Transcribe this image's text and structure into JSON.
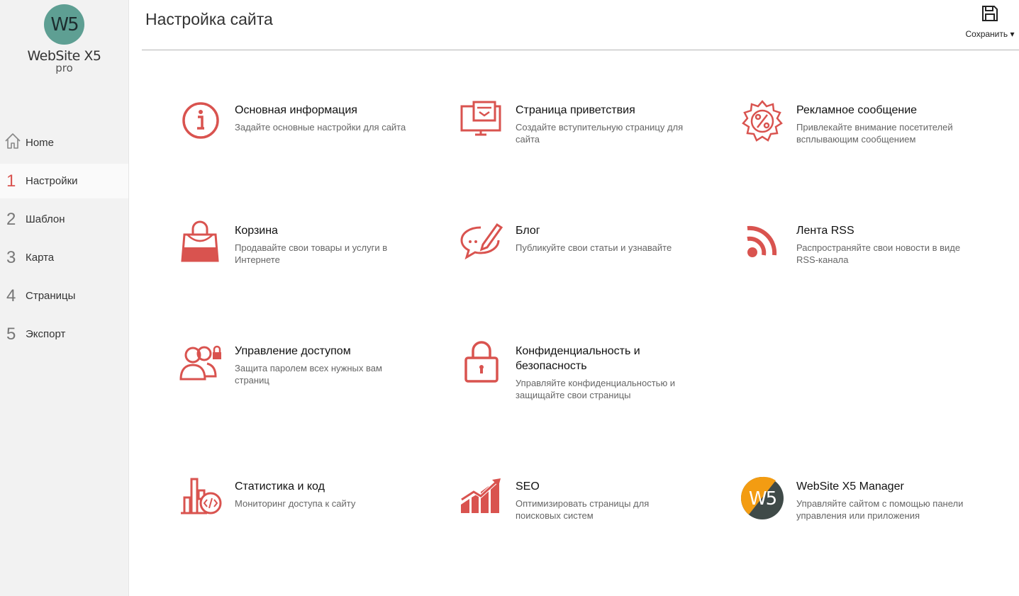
{
  "app": {
    "logo_mark": "W5",
    "logo_name": "WebSite X5",
    "logo_edition": "pro"
  },
  "sidebar": {
    "items": [
      {
        "num": "",
        "label": "Home",
        "icon": "home-icon"
      },
      {
        "num": "1",
        "label": "Настройки"
      },
      {
        "num": "2",
        "label": "Шаблон"
      },
      {
        "num": "3",
        "label": "Карта"
      },
      {
        "num": "4",
        "label": "Страницы"
      },
      {
        "num": "5",
        "label": "Экспорт"
      }
    ],
    "active_index": 1
  },
  "header": {
    "title": "Настройка сайта",
    "save_label": "Сохранить ▾",
    "save_icon": "floppy-disk-icon"
  },
  "colors": {
    "accent": "#d9534f",
    "logo_teal": "#5e9f93",
    "manager_orange": "#f39c12"
  },
  "tiles": [
    {
      "title": "Основная информация",
      "desc": "Задайте основные настройки для сайта",
      "icon": "info-icon"
    },
    {
      "title": "Страница приветствия",
      "desc": "Создайте вступительную страницу для сайта",
      "icon": "monitor-welcome-icon"
    },
    {
      "title": "Рекламное сообщение",
      "desc": "Привлекайте внимание посетителей всплывающим сообщением",
      "icon": "percent-badge-icon"
    },
    {
      "title": "Корзина",
      "desc": "Продавайте свои товары и услуги в Интернете",
      "icon": "shopping-bag-icon"
    },
    {
      "title": "Блог",
      "desc": "Публикуйте свои статьи и узнавайте",
      "icon": "blog-chat-pencil-icon"
    },
    {
      "title": "Лента RSS",
      "desc": "Распространяйте свои новости в виде RSS-канала",
      "icon": "rss-icon"
    },
    {
      "title": "Управление доступом",
      "desc": "Защита паролем всех нужных вам страниц",
      "icon": "users-lock-icon"
    },
    {
      "title": "Конфиденциальность и безопасность",
      "desc": "Управляйте конфиденциальностью и защищайте свои страницы",
      "icon": "padlock-icon"
    },
    {
      "title": "Статистика и код",
      "desc": "Мониторинг доступа к сайту",
      "icon": "stats-code-icon"
    },
    {
      "title": "SEO",
      "desc": "Оптимизировать страницы для поисковых систем",
      "icon": "seo-chart-icon"
    },
    {
      "title": "WebSite X5 Manager",
      "desc": "Управляйте сайтом с помощью панели управления или приложения",
      "icon": "x5-manager-logo-icon"
    }
  ]
}
